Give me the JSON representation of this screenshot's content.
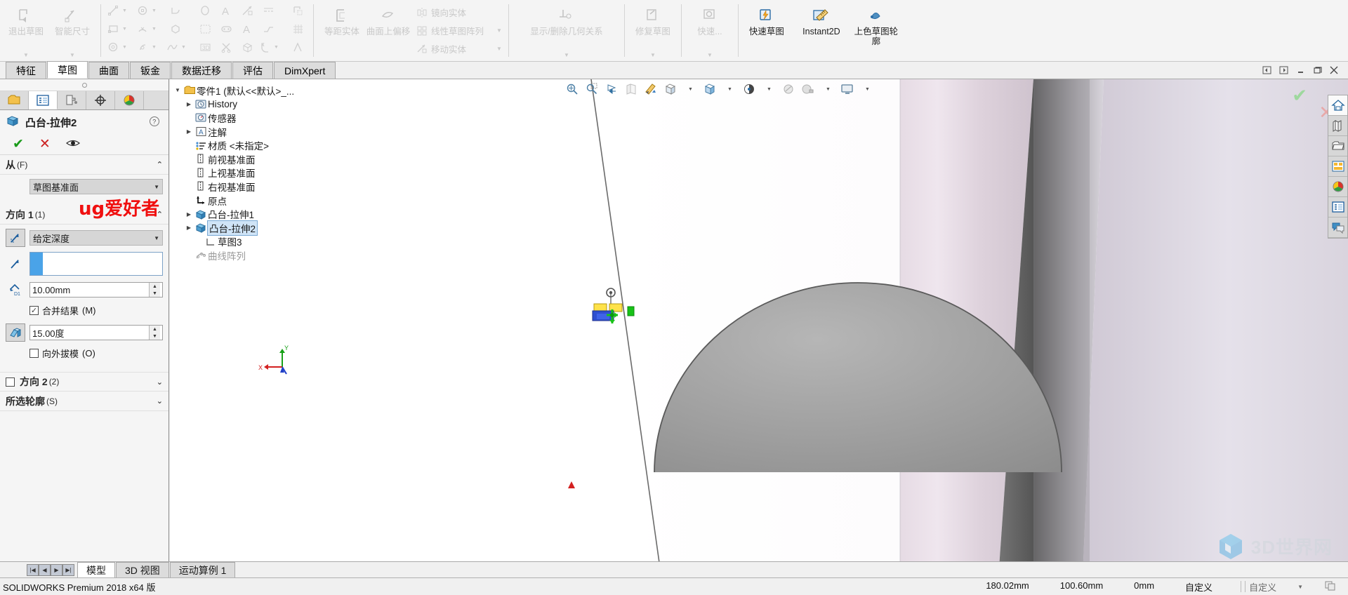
{
  "ribbon": {
    "groups": [
      {
        "name": "sketch-group",
        "big_buttons": [
          {
            "label": "退出草图",
            "icon": "exit-sketch-icon"
          },
          {
            "label": "智能尺寸",
            "icon": "smart-dimension-icon"
          }
        ]
      },
      {
        "name": "entities-group",
        "tool_icons": [
          "line-icon",
          "rectangle-icon",
          "slot-icon",
          "circle-icon",
          "arc-3pt-icon",
          "arrow-rect-icon",
          "tangent-arc-icon",
          "polygon-icon",
          "spline-icon",
          "ellipse-icon",
          "mirror-pattern-icon",
          "3d-sketch-icon",
          "text-icon",
          "slot-straight-icon",
          "trim-icon",
          "point-icon",
          "text-a-icon",
          "box-icon",
          "centerline-icon",
          "jog-icon",
          "fillet-icon",
          "corner-rect-icon",
          "grid-icon",
          "chamfer-icon"
        ]
      },
      {
        "name": "offset-group",
        "big_buttons": [
          {
            "label": "等距实体",
            "icon": "offset-entities-icon"
          },
          {
            "label": "曲面上偏移",
            "icon": "offset-on-surface-icon"
          }
        ],
        "rows": [
          {
            "label": "镜向实体",
            "icon": "mirror-entities-icon",
            "has_caret": false
          },
          {
            "label": "线性草图阵列",
            "icon": "linear-sketch-pattern-icon",
            "has_caret": true
          },
          {
            "label": "移动实体",
            "icon": "move-entities-icon",
            "has_caret": true
          }
        ]
      },
      {
        "name": "relations-group",
        "big_buttons": [
          {
            "label": "显示/删除几何关系",
            "icon": "display-delete-relations-icon"
          }
        ]
      },
      {
        "name": "repair-group",
        "big_buttons": [
          {
            "label": "修复草图",
            "icon": "repair-sketch-icon"
          }
        ]
      },
      {
        "name": "quick-group",
        "big_buttons": [
          {
            "label": "快速...",
            "icon": "quick-snaps-icon"
          }
        ]
      },
      {
        "name": "tools-group",
        "big_buttons": [
          {
            "label": "快速草图",
            "icon": "rapid-sketch-icon",
            "active": true
          },
          {
            "label": "Instant2D",
            "icon": "instant2d-icon",
            "active": true
          },
          {
            "label": "上色草图轮廓",
            "icon": "shaded-sketch-contours-icon",
            "active": true
          }
        ]
      }
    ]
  },
  "tabs": {
    "items": [
      {
        "label": "特征",
        "active": false
      },
      {
        "label": "草图",
        "active": true
      },
      {
        "label": "曲面",
        "active": false
      },
      {
        "label": "钣金",
        "active": false
      },
      {
        "label": "数据迁移",
        "active": false
      },
      {
        "label": "评估",
        "active": false
      },
      {
        "label": "DimXpert",
        "active": false
      }
    ],
    "window_buttons": [
      "restore-left-icon",
      "restore-right-icon",
      "minimize-icon",
      "maximize-icon",
      "close-icon"
    ]
  },
  "property_panel": {
    "panel_tabs": [
      {
        "name": "feature-manager-tab",
        "icon": "feature-tree-icon",
        "active": false
      },
      {
        "name": "property-manager-tab",
        "icon": "property-list-icon",
        "active": true
      },
      {
        "name": "configuration-manager-tab",
        "icon": "configuration-icon",
        "active": false
      },
      {
        "name": "dimxpert-manager-tab",
        "icon": "dimxpert-target-icon",
        "active": false
      },
      {
        "name": "display-manager-tab",
        "icon": "display-sphere-icon",
        "active": false
      }
    ],
    "title": "凸台-拉伸2",
    "title_icon": "extrude-boss-icon",
    "help_icon": "help-question-icon",
    "actions": [
      {
        "name": "accept-button",
        "glyph": "✔"
      },
      {
        "name": "cancel-button",
        "glyph": "✕"
      },
      {
        "name": "preview-button",
        "glyph": "eye-icon"
      }
    ],
    "sections": [
      {
        "name": "from-section",
        "title": "从",
        "suffix": "(F)",
        "collapsed": false,
        "start_condition": "草图基准面"
      },
      {
        "name": "direction1-section",
        "title": "方向 1",
        "suffix": "(1)",
        "collapsed": false,
        "end_condition": "给定深度",
        "reverse_direction_icon": "reverse-direction-icon",
        "direction_ref_placeholder": "",
        "depth_value": "10.00mm",
        "depth_icon": "depth-d1-icon",
        "merge_result": {
          "label": "合并结果",
          "suffix": "(M)",
          "checked": true
        },
        "draft_angle": "15.00度",
        "draft_icon": "draft-angle-icon",
        "draft_outward": {
          "label": "向外拔模",
          "suffix": "(O)",
          "checked": false
        }
      },
      {
        "name": "direction2-section",
        "title": "方向 2",
        "suffix": "(2)",
        "checked": false,
        "collapsed": true
      },
      {
        "name": "selected-contours-section",
        "title": "所选轮廓",
        "suffix": "(S)",
        "collapsed": true
      }
    ]
  },
  "feature_tree": {
    "nodes": [
      {
        "label": "零件1  (默认<<默认>_...",
        "icon": "part-icon",
        "indent": 0,
        "expander": "▼",
        "selected": false
      },
      {
        "label": "History",
        "icon": "history-icon",
        "indent": 1,
        "expander": "▶",
        "selected": false
      },
      {
        "label": "传感器",
        "icon": "sensors-icon",
        "indent": 1,
        "expander": "",
        "selected": false
      },
      {
        "label": "注解",
        "icon": "annotations-icon",
        "indent": 1,
        "expander": "▶",
        "selected": false
      },
      {
        "label": "材质 <未指定>",
        "icon": "material-icon",
        "indent": 1,
        "expander": "",
        "selected": false
      },
      {
        "label": "前视基准面",
        "icon": "plane-icon",
        "indent": 1,
        "expander": "",
        "selected": false
      },
      {
        "label": "上视基准面",
        "icon": "plane-icon",
        "indent": 1,
        "expander": "",
        "selected": false
      },
      {
        "label": "右视基准面",
        "icon": "plane-icon",
        "indent": 1,
        "expander": "",
        "selected": false
      },
      {
        "label": "原点",
        "icon": "origin-icon",
        "indent": 1,
        "expander": "",
        "selected": false
      },
      {
        "label": "凸台-拉伸1",
        "icon": "extrude-boss-icon",
        "indent": 1,
        "expander": "▶",
        "selected": false
      },
      {
        "label": "凸台-拉伸2",
        "icon": "extrude-boss-icon",
        "indent": 1,
        "expander": "▶",
        "selected": true
      },
      {
        "label": "草图3",
        "icon": "sketch-icon",
        "indent": 2,
        "expander": "",
        "selected": false
      },
      {
        "label": "曲线阵列",
        "icon": "curve-pattern-icon",
        "indent": 1,
        "expander": "",
        "selected": false,
        "dim": true
      }
    ]
  },
  "viewport": {
    "toolbar_icons": [
      "zoom-to-fit-icon",
      "zoom-to-area-icon",
      "previous-view-icon",
      "section-view-icon",
      "view-orientation-icon",
      "display-style-icon",
      "hide-show-items-icon",
      "edit-appearance-icon",
      "apply-scene-icon",
      "view-settings-icon"
    ],
    "confirm_icon": "confirm-check-icon",
    "cancel_icon": "cancel-x-icon",
    "overlay_text": "ug爱好者",
    "watermark_text": "3D世界网",
    "task_pane_buttons": [
      {
        "name": "sw-resources-button",
        "icon": "home-icon",
        "active": true
      },
      {
        "name": "design-library-button",
        "icon": "library-icon",
        "active": false
      },
      {
        "name": "file-explorer-button",
        "icon": "folder-icon",
        "active": false
      },
      {
        "name": "view-palette-button",
        "icon": "view-palette-icon",
        "active": false
      },
      {
        "name": "appearances-scenes-button",
        "icon": "appearances-sphere-icon",
        "active": false
      },
      {
        "name": "custom-properties-button",
        "icon": "custom-properties-icon",
        "active": false
      },
      {
        "name": "solidworks-forum-button",
        "icon": "forum-icon",
        "active": false
      }
    ]
  },
  "bottom_tabs": {
    "nav_buttons": [
      "first-icon",
      "prev-icon",
      "next-icon",
      "last-icon"
    ],
    "items": [
      {
        "label": "模型",
        "active": true
      },
      {
        "label": "3D 视图",
        "active": false
      },
      {
        "label": "运动算例 1",
        "active": false
      }
    ]
  },
  "status_bar": {
    "message": "SOLIDWORKS Premium 2018 x64 版",
    "coord_x": "180.02mm",
    "coord_y": "100.60mm",
    "coord_z": "0mm",
    "units_label": "自定义",
    "editing_label": "自定义",
    "overlay_icon": "overlay-icon"
  }
}
